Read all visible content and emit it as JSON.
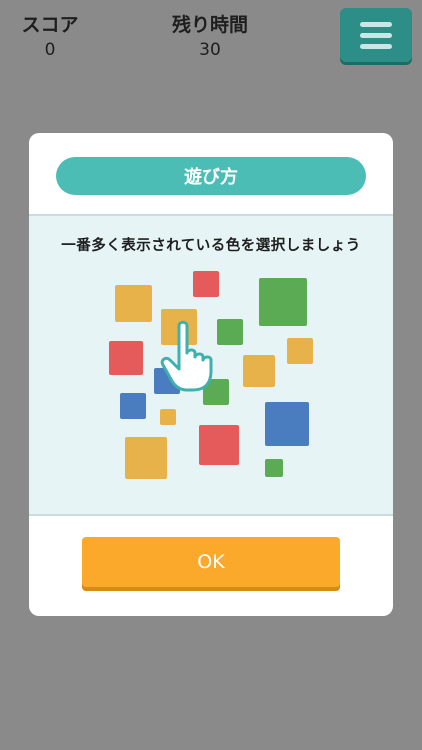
{
  "hud": {
    "score_label": "スコア",
    "score_value": "0",
    "time_label": "残り時間",
    "time_value": "30"
  },
  "menu": {
    "icon": "hamburger-menu-icon"
  },
  "modal": {
    "title": "遊び方",
    "instruction": "一番多く表示されている色を選択しましょう",
    "ok_label": "OK"
  },
  "colors": {
    "background": "#8a8a8a",
    "menu_button": "#2d8e88",
    "title_bar": "#4bbdb5",
    "panel": "#e6f4f5",
    "ok_button": "#fba92b",
    "square_yellow": "#e8b24a",
    "square_red": "#e55a5a",
    "square_green": "#5aab53",
    "square_blue": "#4a7cc0"
  }
}
